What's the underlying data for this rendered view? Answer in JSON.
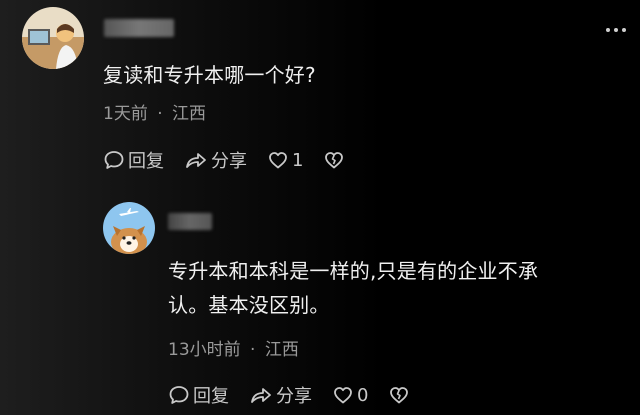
{
  "comments": [
    {
      "text": "复读和专升本哪一个好?",
      "time": "1天前",
      "location": "江西",
      "reply_label": "回复",
      "share_label": "分享",
      "like_count": "1"
    },
    {
      "text_line1": "专升本和本科是一样的,只是有的企业不承",
      "text_line2": "认。基本没区别。",
      "time": "13小时前",
      "location": "江西",
      "reply_label": "回复",
      "share_label": "分享",
      "like_count": "0"
    }
  ],
  "separator": "·",
  "icons": {
    "reply": "speech-bubble-icon",
    "share": "share-arrow-icon",
    "like": "heart-icon",
    "dislike": "broken-heart-icon",
    "more": "more-dots-icon"
  },
  "colors": {
    "text": "#f0f0f0",
    "meta": "#9a9a9a",
    "action": "#c9c9c9"
  }
}
